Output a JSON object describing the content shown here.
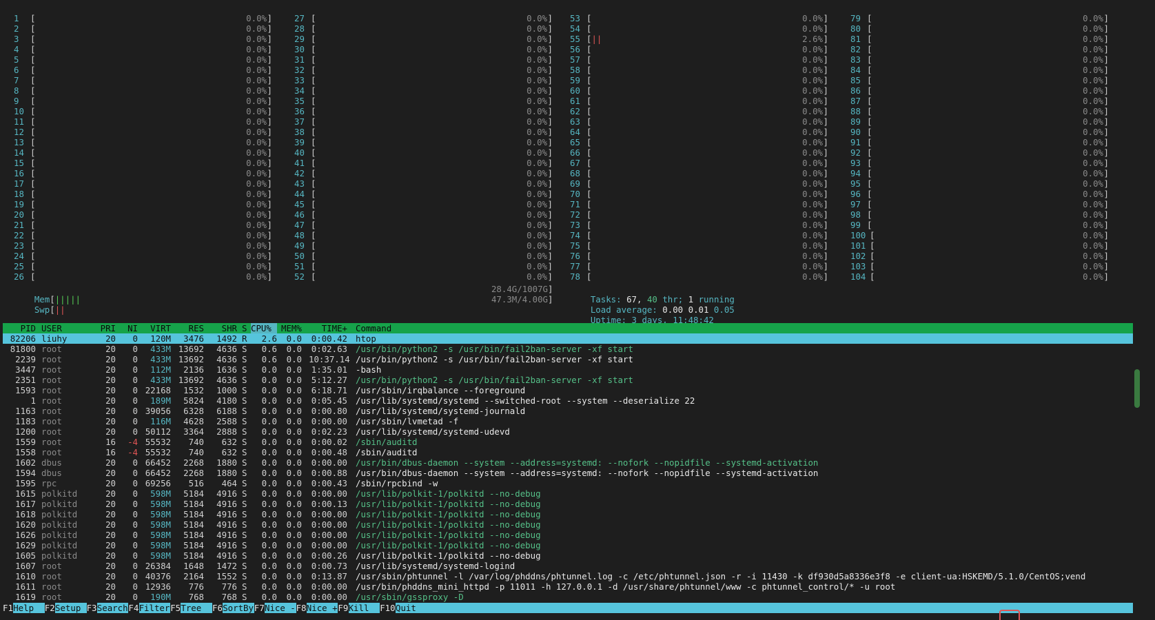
{
  "cpus": [
    {
      "n": "1",
      "pct": "0.0%"
    },
    {
      "n": "2",
      "pct": "0.0%"
    },
    {
      "n": "3",
      "pct": "0.0%"
    },
    {
      "n": "4",
      "pct": "0.0%"
    },
    {
      "n": "5",
      "pct": "0.0%"
    },
    {
      "n": "6",
      "pct": "0.0%"
    },
    {
      "n": "7",
      "pct": "0.0%"
    },
    {
      "n": "8",
      "pct": "0.0%"
    },
    {
      "n": "9",
      "pct": "0.0%"
    },
    {
      "n": "10",
      "pct": "0.0%"
    },
    {
      "n": "11",
      "pct": "0.0%"
    },
    {
      "n": "12",
      "pct": "0.0%"
    },
    {
      "n": "13",
      "pct": "0.0%"
    },
    {
      "n": "14",
      "pct": "0.0%"
    },
    {
      "n": "15",
      "pct": "0.0%"
    },
    {
      "n": "16",
      "pct": "0.0%"
    },
    {
      "n": "17",
      "pct": "0.0%"
    },
    {
      "n": "18",
      "pct": "0.0%"
    },
    {
      "n": "19",
      "pct": "0.0%"
    },
    {
      "n": "20",
      "pct": "0.0%"
    },
    {
      "n": "21",
      "pct": "0.0%"
    },
    {
      "n": "22",
      "pct": "0.0%"
    },
    {
      "n": "23",
      "pct": "0.0%"
    },
    {
      "n": "24",
      "pct": "0.0%"
    },
    {
      "n": "25",
      "pct": "0.0%"
    },
    {
      "n": "26",
      "pct": "0.0%"
    },
    {
      "n": "27",
      "pct": "0.0%"
    },
    {
      "n": "28",
      "pct": "0.0%"
    },
    {
      "n": "29",
      "pct": "0.0%"
    },
    {
      "n": "30",
      "pct": "0.0%"
    },
    {
      "n": "31",
      "pct": "0.0%"
    },
    {
      "n": "32",
      "pct": "0.0%"
    },
    {
      "n": "33",
      "pct": "0.0%"
    },
    {
      "n": "34",
      "pct": "0.0%"
    },
    {
      "n": "35",
      "pct": "0.0%"
    },
    {
      "n": "36",
      "pct": "0.0%"
    },
    {
      "n": "37",
      "pct": "0.0%"
    },
    {
      "n": "38",
      "pct": "0.0%"
    },
    {
      "n": "39",
      "pct": "0.0%"
    },
    {
      "n": "40",
      "pct": "0.0%"
    },
    {
      "n": "41",
      "pct": "0.0%"
    },
    {
      "n": "42",
      "pct": "0.0%"
    },
    {
      "n": "43",
      "pct": "0.0%"
    },
    {
      "n": "44",
      "pct": "0.0%"
    },
    {
      "n": "45",
      "pct": "0.0%"
    },
    {
      "n": "46",
      "pct": "0.0%"
    },
    {
      "n": "47",
      "pct": "0.0%"
    },
    {
      "n": "48",
      "pct": "0.0%"
    },
    {
      "n": "49",
      "pct": "0.0%"
    },
    {
      "n": "50",
      "pct": "0.0%"
    },
    {
      "n": "51",
      "pct": "0.0%"
    },
    {
      "n": "52",
      "pct": "0.0%"
    },
    {
      "n": "53",
      "pct": "0.0%"
    },
    {
      "n": "54",
      "pct": "0.0%"
    },
    {
      "n": "55",
      "pct": "2.6%",
      "bar": "||"
    },
    {
      "n": "56",
      "pct": "0.0%"
    },
    {
      "n": "57",
      "pct": "0.0%"
    },
    {
      "n": "58",
      "pct": "0.0%"
    },
    {
      "n": "59",
      "pct": "0.0%"
    },
    {
      "n": "60",
      "pct": "0.0%"
    },
    {
      "n": "61",
      "pct": "0.0%"
    },
    {
      "n": "62",
      "pct": "0.0%"
    },
    {
      "n": "63",
      "pct": "0.0%"
    },
    {
      "n": "64",
      "pct": "0.0%"
    },
    {
      "n": "65",
      "pct": "0.0%"
    },
    {
      "n": "66",
      "pct": "0.0%"
    },
    {
      "n": "67",
      "pct": "0.0%"
    },
    {
      "n": "68",
      "pct": "0.0%"
    },
    {
      "n": "69",
      "pct": "0.0%"
    },
    {
      "n": "70",
      "pct": "0.0%"
    },
    {
      "n": "71",
      "pct": "0.0%"
    },
    {
      "n": "72",
      "pct": "0.0%"
    },
    {
      "n": "73",
      "pct": "0.0%"
    },
    {
      "n": "74",
      "pct": "0.0%"
    },
    {
      "n": "75",
      "pct": "0.0%"
    },
    {
      "n": "76",
      "pct": "0.0%"
    },
    {
      "n": "77",
      "pct": "0.0%"
    },
    {
      "n": "78",
      "pct": "0.0%"
    },
    {
      "n": "79",
      "pct": "0.0%"
    },
    {
      "n": "80",
      "pct": "0.0%"
    },
    {
      "n": "81",
      "pct": "0.0%"
    },
    {
      "n": "82",
      "pct": "0.0%"
    },
    {
      "n": "83",
      "pct": "0.0%"
    },
    {
      "n": "84",
      "pct": "0.0%"
    },
    {
      "n": "85",
      "pct": "0.0%"
    },
    {
      "n": "86",
      "pct": "0.0%"
    },
    {
      "n": "87",
      "pct": "0.0%"
    },
    {
      "n": "88",
      "pct": "0.0%"
    },
    {
      "n": "89",
      "pct": "0.0%"
    },
    {
      "n": "90",
      "pct": "0.0%"
    },
    {
      "n": "91",
      "pct": "0.0%"
    },
    {
      "n": "92",
      "pct": "0.0%"
    },
    {
      "n": "93",
      "pct": "0.0%"
    },
    {
      "n": "94",
      "pct": "0.0%"
    },
    {
      "n": "95",
      "pct": "0.0%"
    },
    {
      "n": "96",
      "pct": "0.0%"
    },
    {
      "n": "97",
      "pct": "0.0%"
    },
    {
      "n": "98",
      "pct": "0.0%"
    },
    {
      "n": "99",
      "pct": "0.0%"
    },
    {
      "n": "100",
      "pct": "0.0%"
    },
    {
      "n": "101",
      "pct": "0.0%"
    },
    {
      "n": "102",
      "pct": "0.0%"
    },
    {
      "n": "103",
      "pct": "0.0%"
    },
    {
      "n": "104",
      "pct": "0.0%"
    }
  ],
  "mem": {
    "label": "Mem",
    "bar": "|||||",
    "value": "28.4G/1007G"
  },
  "swp": {
    "label": "Swp",
    "bar": "||",
    "value": "47.3M/4.00G"
  },
  "tasks": {
    "label": "Tasks:",
    "count": "67,",
    "thr": "40",
    "thr_label": "thr;",
    "running": "1",
    "running_label": "running"
  },
  "load": {
    "label": "Load average:",
    "v1": "0.00",
    "v2": "0.01",
    "v3": "0.05"
  },
  "uptime": {
    "label": "Uptime:",
    "value": "3 days, 11:48:42"
  },
  "columns": {
    "pid": "PID",
    "user": "USER",
    "pri": "PRI",
    "ni": "NI",
    "virt": "VIRT",
    "res": "RES",
    "shr": "SHR",
    "s": "S",
    "cpu": "CPU%",
    "mem": "MEM%",
    "time": "TIME+",
    "cmd": "Command"
  },
  "processes": [
    {
      "pid": "82206",
      "user": "liuhy",
      "pri": "20",
      "ni": "0",
      "virt": "120M",
      "res": "3476",
      "shr": "1492",
      "s": "R",
      "cpu": "2.6",
      "mem": "0.0",
      "time": "0:00.42",
      "cmd": "htop",
      "selected": true
    },
    {
      "pid": "81800",
      "user": "root",
      "pri": "20",
      "ni": "0",
      "virt": "433M",
      "res": "13692",
      "shr": "4636",
      "s": "S",
      "cpu": "0.6",
      "mem": "0.0",
      "time": "0:02.63",
      "cmd": "/usr/bin/python2 -s /usr/bin/fail2ban-server -xf start",
      "thread": true
    },
    {
      "pid": "2239",
      "user": "root",
      "pri": "20",
      "ni": "0",
      "virt": "433M",
      "res": "13692",
      "shr": "4636",
      "s": "S",
      "cpu": "0.6",
      "mem": "0.0",
      "time": "10:37.14",
      "cmd": "/usr/bin/python2 -s /usr/bin/fail2ban-server -xf start"
    },
    {
      "pid": "3447",
      "user": "root",
      "pri": "20",
      "ni": "0",
      "virt": "112M",
      "res": "2136",
      "shr": "1636",
      "s": "S",
      "cpu": "0.0",
      "mem": "0.0",
      "time": "1:35.01",
      "cmd": "-bash"
    },
    {
      "pid": "2351",
      "user": "root",
      "pri": "20",
      "ni": "0",
      "virt": "433M",
      "res": "13692",
      "shr": "4636",
      "s": "S",
      "cpu": "0.0",
      "mem": "0.0",
      "time": "5:12.27",
      "cmd": "/usr/bin/python2 -s /usr/bin/fail2ban-server -xf start",
      "thread": true
    },
    {
      "pid": "1593",
      "user": "root",
      "pri": "20",
      "ni": "0",
      "virt": "22168",
      "res": "1532",
      "shr": "1000",
      "s": "S",
      "cpu": "0.0",
      "mem": "0.0",
      "time": "6:18.71",
      "cmd": "/usr/sbin/irqbalance --foreground"
    },
    {
      "pid": "1",
      "user": "root",
      "pri": "20",
      "ni": "0",
      "virt": "189M",
      "res": "5824",
      "shr": "4180",
      "s": "S",
      "cpu": "0.0",
      "mem": "0.0",
      "time": "0:05.45",
      "cmd": "/usr/lib/systemd/systemd --switched-root --system --deserialize 22"
    },
    {
      "pid": "1163",
      "user": "root",
      "pri": "20",
      "ni": "0",
      "virt": "39056",
      "res": "6328",
      "shr": "6188",
      "s": "S",
      "cpu": "0.0",
      "mem": "0.0",
      "time": "0:00.80",
      "cmd": "/usr/lib/systemd/systemd-journald"
    },
    {
      "pid": "1183",
      "user": "root",
      "pri": "20",
      "ni": "0",
      "virt": "116M",
      "res": "4628",
      "shr": "2588",
      "s": "S",
      "cpu": "0.0",
      "mem": "0.0",
      "time": "0:00.00",
      "cmd": "/usr/sbin/lvmetad -f"
    },
    {
      "pid": "1200",
      "user": "root",
      "pri": "20",
      "ni": "0",
      "virt": "50112",
      "res": "3364",
      "shr": "2888",
      "s": "S",
      "cpu": "0.0",
      "mem": "0.0",
      "time": "0:02.23",
      "cmd": "/usr/lib/systemd/systemd-udevd"
    },
    {
      "pid": "1559",
      "user": "root",
      "pri": "16",
      "ni": "-4",
      "virt": "55532",
      "res": "740",
      "shr": "632",
      "s": "S",
      "cpu": "0.0",
      "mem": "0.0",
      "time": "0:00.02",
      "cmd": "/sbin/auditd",
      "thread": true
    },
    {
      "pid": "1558",
      "user": "root",
      "pri": "16",
      "ni": "-4",
      "virt": "55532",
      "res": "740",
      "shr": "632",
      "s": "S",
      "cpu": "0.0",
      "mem": "0.0",
      "time": "0:00.48",
      "cmd": "/sbin/auditd"
    },
    {
      "pid": "1602",
      "user": "dbus",
      "pri": "20",
      "ni": "0",
      "virt": "66452",
      "res": "2268",
      "shr": "1880",
      "s": "S",
      "cpu": "0.0",
      "mem": "0.0",
      "time": "0:00.00",
      "cmd": "/usr/bin/dbus-daemon --system --address=systemd: --nofork --nopidfile --systemd-activation",
      "thread": true
    },
    {
      "pid": "1594",
      "user": "dbus",
      "pri": "20",
      "ni": "0",
      "virt": "66452",
      "res": "2268",
      "shr": "1880",
      "s": "S",
      "cpu": "0.0",
      "mem": "0.0",
      "time": "0:00.88",
      "cmd": "/usr/bin/dbus-daemon --system --address=systemd: --nofork --nopidfile --systemd-activation"
    },
    {
      "pid": "1595",
      "user": "rpc",
      "pri": "20",
      "ni": "0",
      "virt": "69256",
      "res": "516",
      "shr": "464",
      "s": "S",
      "cpu": "0.0",
      "mem": "0.0",
      "time": "0:00.43",
      "cmd": "/sbin/rpcbind -w"
    },
    {
      "pid": "1615",
      "user": "polkitd",
      "pri": "20",
      "ni": "0",
      "virt": "598M",
      "res": "5184",
      "shr": "4916",
      "s": "S",
      "cpu": "0.0",
      "mem": "0.0",
      "time": "0:00.00",
      "cmd": "/usr/lib/polkit-1/polkitd --no-debug",
      "thread": true
    },
    {
      "pid": "1617",
      "user": "polkitd",
      "pri": "20",
      "ni": "0",
      "virt": "598M",
      "res": "5184",
      "shr": "4916",
      "s": "S",
      "cpu": "0.0",
      "mem": "0.0",
      "time": "0:00.13",
      "cmd": "/usr/lib/polkit-1/polkitd --no-debug",
      "thread": true
    },
    {
      "pid": "1618",
      "user": "polkitd",
      "pri": "20",
      "ni": "0",
      "virt": "598M",
      "res": "5184",
      "shr": "4916",
      "s": "S",
      "cpu": "0.0",
      "mem": "0.0",
      "time": "0:00.00",
      "cmd": "/usr/lib/polkit-1/polkitd --no-debug",
      "thread": true
    },
    {
      "pid": "1620",
      "user": "polkitd",
      "pri": "20",
      "ni": "0",
      "virt": "598M",
      "res": "5184",
      "shr": "4916",
      "s": "S",
      "cpu": "0.0",
      "mem": "0.0",
      "time": "0:00.00",
      "cmd": "/usr/lib/polkit-1/polkitd --no-debug",
      "thread": true
    },
    {
      "pid": "1626",
      "user": "polkitd",
      "pri": "20",
      "ni": "0",
      "virt": "598M",
      "res": "5184",
      "shr": "4916",
      "s": "S",
      "cpu": "0.0",
      "mem": "0.0",
      "time": "0:00.00",
      "cmd": "/usr/lib/polkit-1/polkitd --no-debug",
      "thread": true
    },
    {
      "pid": "1629",
      "user": "polkitd",
      "pri": "20",
      "ni": "0",
      "virt": "598M",
      "res": "5184",
      "shr": "4916",
      "s": "S",
      "cpu": "0.0",
      "mem": "0.0",
      "time": "0:00.00",
      "cmd": "/usr/lib/polkit-1/polkitd --no-debug",
      "thread": true
    },
    {
      "pid": "1605",
      "user": "polkitd",
      "pri": "20",
      "ni": "0",
      "virt": "598M",
      "res": "5184",
      "shr": "4916",
      "s": "S",
      "cpu": "0.0",
      "mem": "0.0",
      "time": "0:00.26",
      "cmd": "/usr/lib/polkit-1/polkitd --no-debug"
    },
    {
      "pid": "1607",
      "user": "root",
      "pri": "20",
      "ni": "0",
      "virt": "26384",
      "res": "1648",
      "shr": "1472",
      "s": "S",
      "cpu": "0.0",
      "mem": "0.0",
      "time": "0:00.73",
      "cmd": "/usr/lib/systemd/systemd-logind"
    },
    {
      "pid": "1610",
      "user": "root",
      "pri": "20",
      "ni": "0",
      "virt": "40376",
      "res": "2164",
      "shr": "1552",
      "s": "S",
      "cpu": "0.0",
      "mem": "0.0",
      "time": "0:13.87",
      "cmd": "/usr/sbin/phtunnel -l /var/log/phddns/phtunnel.log -c /etc/phtunnel.json -r -i 11430 -k df930d5a8336e3f8 -e client-ua:HSKEMD/5.1.0/CentOS;vend"
    },
    {
      "pid": "1611",
      "user": "root",
      "pri": "20",
      "ni": "0",
      "virt": "12936",
      "res": "776",
      "shr": "776",
      "s": "S",
      "cpu": "0.0",
      "mem": "0.0",
      "time": "0:00.00",
      "cmd": "/usr/bin/phddns_mini_httpd -p 11011 -h 127.0.0.1 -d /usr/share/phtunnel/www -c phtunnel_control/* -u root"
    },
    {
      "pid": "1619",
      "user": "root",
      "pri": "20",
      "ni": "0",
      "virt": "190M",
      "res": "768",
      "shr": "768",
      "s": "S",
      "cpu": "0.0",
      "mem": "0.0",
      "time": "0:00.00",
      "cmd": "/usr/sbin/gssproxy -D",
      "thread": true
    }
  ],
  "fkeys": [
    {
      "key": "F1",
      "label": "Help  "
    },
    {
      "key": "F2",
      "label": "Setup "
    },
    {
      "key": "F3",
      "label": "Search"
    },
    {
      "key": "F4",
      "label": "Filter"
    },
    {
      "key": "F5",
      "label": "Tree  "
    },
    {
      "key": "F6",
      "label": "SortBy"
    },
    {
      "key": "F7",
      "label": "Nice -"
    },
    {
      "key": "F8",
      "label": "Nice +"
    },
    {
      "key": "F9",
      "label": "Kill  "
    },
    {
      "key": "F10",
      "label": "Quit  "
    }
  ],
  "colors": {
    "header_bg": "#16a34a",
    "selected_bg": "#56c4dc",
    "cyan": "#56b6c2",
    "green_thread": "#55c088"
  }
}
